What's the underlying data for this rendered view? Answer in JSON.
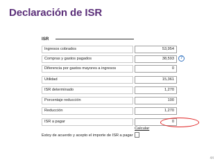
{
  "slide": {
    "title": "Declaración de ISR",
    "page_number": "44"
  },
  "form": {
    "section_title": "ISR",
    "rows": [
      {
        "label": "Ingresos cobrados",
        "value": "53,954"
      },
      {
        "label": "Compras y gastos pagados",
        "value": "38,593"
      },
      {
        "label": "Diferencia por gastos mayores a ingresos",
        "value": "0"
      },
      {
        "label": "Utilidad",
        "value": "15,361"
      },
      {
        "label": "ISR determinado",
        "value": "1,270"
      },
      {
        "label": "Porcentaje reducción",
        "value": "100"
      },
      {
        "label": "Reducción",
        "value": "1,270"
      },
      {
        "label": "ISR a pagar",
        "value": "0"
      }
    ],
    "help_icon": "question-icon",
    "help_symbol": "?",
    "calculate_label": "Calcular",
    "accept_label": "Estoy de acuerdo y acepto el importe de ISR a pagar",
    "accept_checked": false
  },
  "colors": {
    "title": "#5b2f79",
    "highlight": "#e02020",
    "help_icon": "#3a78c2"
  }
}
